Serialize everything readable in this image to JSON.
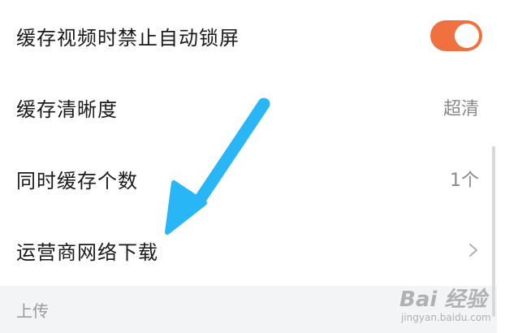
{
  "settings": {
    "rows": [
      {
        "label": "缓存视频时禁止自动锁屏",
        "control": "toggle",
        "toggle_on": true
      },
      {
        "label": "缓存清晰度",
        "value": "超清"
      },
      {
        "label": "同时缓存个数",
        "value": "1个"
      },
      {
        "label": "运营商网络下载",
        "control": "chevron"
      }
    ],
    "section_header": "上传"
  },
  "colors": {
    "toggle_on": "#f0703f",
    "arrow": "#29b6f6"
  },
  "icons": {
    "chevron": "chevron-right-icon",
    "annotation": "arrow-annotation-icon"
  },
  "watermark": {
    "main": "Bai 经验",
    "sub": "jingyan.baidu.com"
  }
}
